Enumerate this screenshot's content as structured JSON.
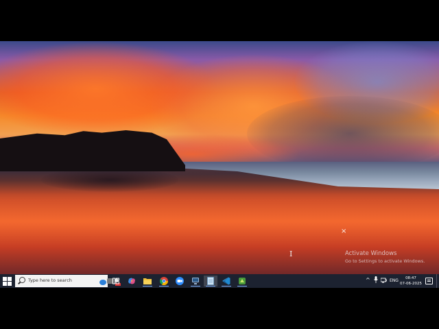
{
  "desktop": {
    "wallpaper": "sunset-beach-wallpaper",
    "close_glyph": "×",
    "text_cursor_glyph": "I",
    "watermark": {
      "title": "Activate Windows",
      "subtitle": "Go to Settings to activate Windows."
    }
  },
  "taskbar": {
    "search": {
      "placeholder": "Type here to search"
    },
    "pinned": [
      {
        "name": "task-view",
        "icon": "task-view-icon"
      },
      {
        "name": "copilot",
        "icon": "copilot-icon"
      },
      {
        "name": "file-explorer",
        "icon": "folder-icon"
      },
      {
        "name": "chrome",
        "icon": "chrome-icon"
      },
      {
        "name": "zoom",
        "icon": "zoom-icon"
      },
      {
        "name": "remote-desktop",
        "icon": "remote-desktop-icon"
      },
      {
        "name": "notepad",
        "icon": "notepad-icon"
      },
      {
        "name": "vscode",
        "icon": "vscode-icon"
      },
      {
        "name": "app",
        "icon": "app-icon"
      }
    ],
    "tray": {
      "chevron": "^",
      "language": "ENG",
      "time": "08:47",
      "date": "07-06-2025"
    }
  },
  "colors": {
    "taskbar": "#1c2230",
    "search_box": "#f3f3f3",
    "active_underline": "#7fb3ff"
  }
}
